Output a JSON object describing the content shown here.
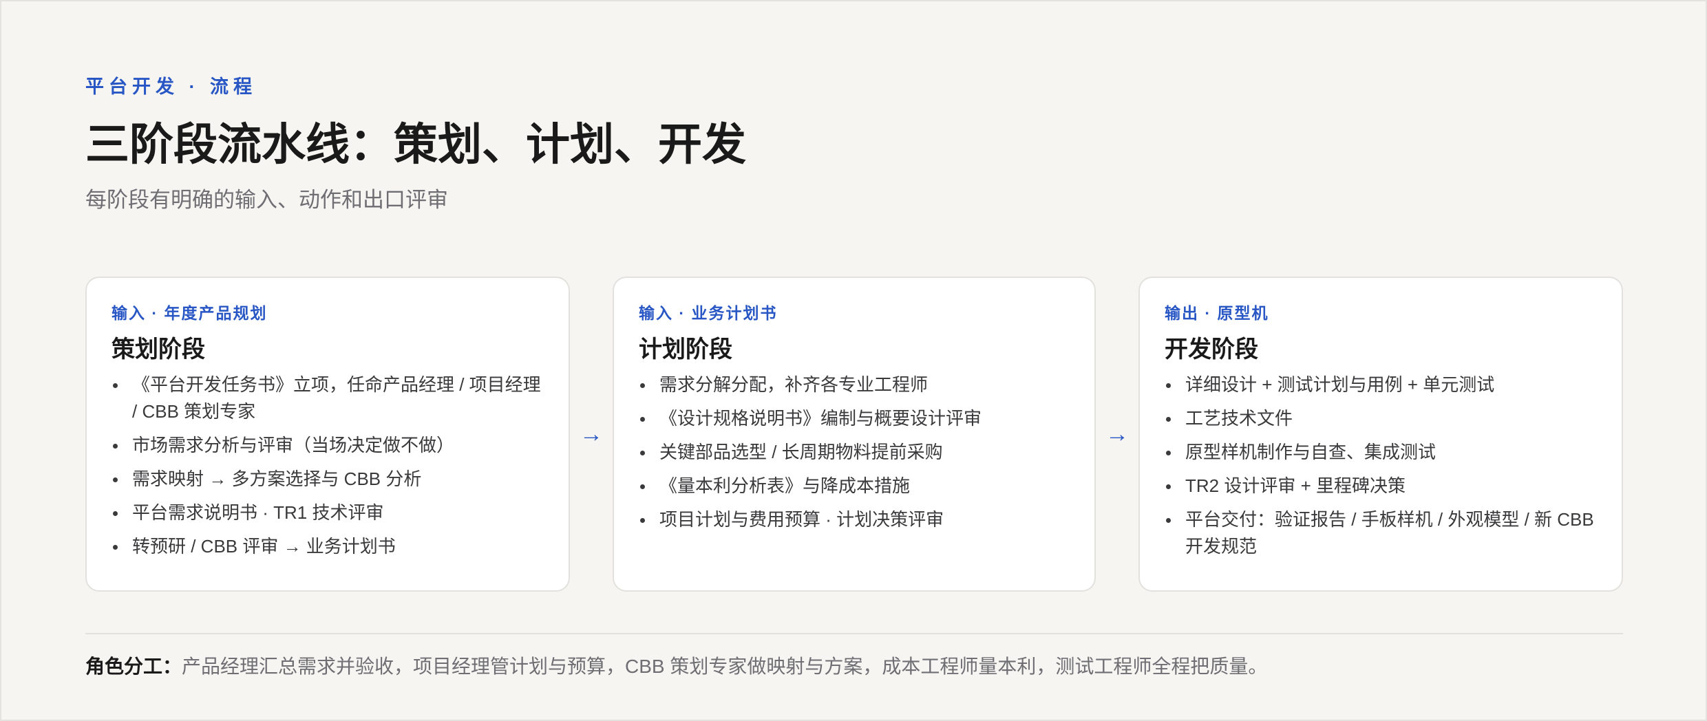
{
  "header": {
    "eyebrow": "平台开发 · 流程",
    "title": "三阶段流水线：策划、计划、开发",
    "subtitle": "每阶段有明确的输入、动作和出口评审"
  },
  "stages": [
    {
      "eyebrow": "输入 · 年度产品规划",
      "title": "策划阶段",
      "items": [
        "《平台开发任务书》立项，任命产品经理 / 项目经理 / CBB 策划专家",
        "市场需求分析与评审（当场决定做不做）",
        "需求映射 → 多方案选择与 CBB 分析",
        "平台需求说明书 · TR1 技术评审",
        "转预研 / CBB 评审 → 业务计划书"
      ]
    },
    {
      "eyebrow": "输入 · 业务计划书",
      "title": "计划阶段",
      "items": [
        "需求分解分配，补齐各专业工程师",
        "《设计规格说明书》编制与概要设计评审",
        "关键部品选型 / 长周期物料提前采购",
        "《量本利分析表》与降成本措施",
        "项目计划与费用预算 · 计划决策评审"
      ]
    },
    {
      "eyebrow": "输出 · 原型机",
      "title": "开发阶段",
      "items": [
        "详细设计 + 测试计划与用例 + 单元测试",
        "工艺技术文件",
        "原型样机制作与自查、集成测试",
        "TR2 设计评审 + 里程碑决策",
        "平台交付：验证报告 / 手板样机 / 外观模型 / 新 CBB 开发规范"
      ]
    }
  ],
  "arrows": [
    "→",
    "→"
  ],
  "footer": {
    "label": "角色分工：",
    "text": "产品经理汇总需求并验收，项目经理管计划与预算，CBB 策划专家做映射与方案，成本工程师量本利，测试工程师全程把质量。"
  },
  "colors": {
    "accent": "#2857c5",
    "background": "#f6f5f2",
    "card": "#ffffff"
  }
}
